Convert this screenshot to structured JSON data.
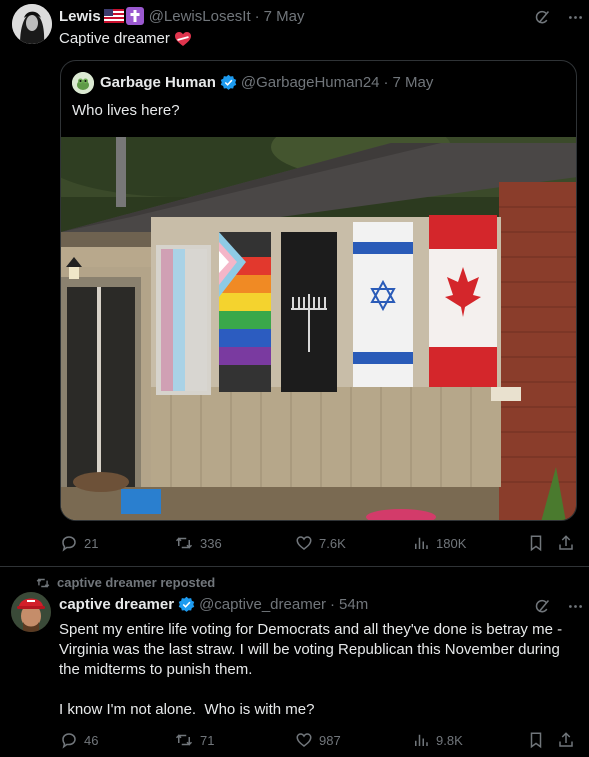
{
  "post1": {
    "author_name": "Lewis",
    "author_handle": "@LewisLosesIt",
    "separator": "·",
    "time": "7 May",
    "text": "Captive dreamer",
    "quote": {
      "author_name": "Garbage Human",
      "author_handle": "@GarbageHuman24",
      "separator": "·",
      "time": "7 May",
      "text": "Who lives here?"
    },
    "stats": {
      "replies": "21",
      "reposts": "336",
      "likes": "7.6K",
      "views": "180K"
    }
  },
  "post2": {
    "reposted_by": "captive dreamer reposted",
    "author_name": "captive dreamer",
    "author_handle": "@captive_dreamer",
    "separator": "·",
    "time": "54m",
    "text": "Spent my entire life voting for Democrats and all they've done is betray me - Virginia was the last straw. I will be voting Republican this November during the midterms to punish them.\n\nI know I'm not alone.  Who is with me?",
    "stats": {
      "replies": "46",
      "reposts": "71",
      "likes": "987",
      "views": "9.8K"
    }
  },
  "colors": {
    "background": "#000000",
    "text": "#e7e9ea",
    "muted": "#71767b",
    "verified": "#1d9bf0",
    "border": "#2f3336"
  },
  "icons": [
    "grok-icon",
    "more-icon",
    "reply-icon",
    "repost-icon",
    "like-icon",
    "views-icon",
    "bookmark-icon",
    "share-icon",
    "verified-icon",
    "us-flag-emoji",
    "cross-emoji",
    "heart-emoji"
  ]
}
